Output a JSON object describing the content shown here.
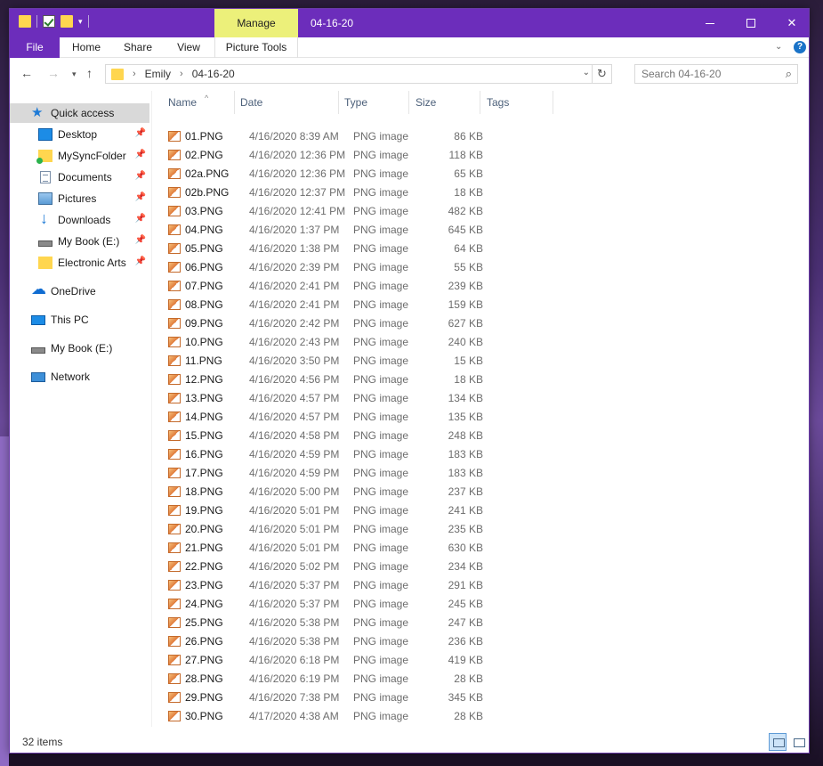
{
  "window": {
    "title": "04-16-20",
    "manage_label": "Manage",
    "controls": {
      "minimize": "minimize",
      "maximize": "maximize",
      "close": "✕"
    }
  },
  "ribbon": {
    "tabs": [
      "File",
      "Home",
      "Share",
      "View",
      "Picture Tools"
    ],
    "help": "?"
  },
  "address": {
    "crumbs": [
      "Emily",
      "04-16-20"
    ],
    "search_placeholder": "Search 04-16-20"
  },
  "nav": {
    "quick_access": "Quick access",
    "pinned": [
      {
        "label": "Desktop",
        "icon": "desktop-icon"
      },
      {
        "label": "MySyncFolder",
        "icon": "sync-folder-icon"
      },
      {
        "label": "Documents",
        "icon": "documents-icon"
      },
      {
        "label": "Pictures",
        "icon": "pictures-icon"
      },
      {
        "label": "Downloads",
        "icon": "downloads-icon"
      },
      {
        "label": "My Book (E:)",
        "icon": "drive-icon"
      },
      {
        "label": "Electronic Arts",
        "icon": "folder-icon"
      }
    ],
    "onedrive": "OneDrive",
    "this_pc": "This PC",
    "mybook": "My Book (E:)",
    "network": "Network"
  },
  "columns": [
    "Name",
    "Date",
    "Type",
    "Size",
    "Tags"
  ],
  "files": [
    {
      "name": "01.PNG",
      "date": "4/16/2020 8:39 AM",
      "type": "PNG image",
      "size": "86 KB"
    },
    {
      "name": "02.PNG",
      "date": "4/16/2020 12:36 PM",
      "type": "PNG image",
      "size": "118 KB"
    },
    {
      "name": "02a.PNG",
      "date": "4/16/2020 12:36 PM",
      "type": "PNG image",
      "size": "65 KB"
    },
    {
      "name": "02b.PNG",
      "date": "4/16/2020 12:37 PM",
      "type": "PNG image",
      "size": "18 KB"
    },
    {
      "name": "03.PNG",
      "date": "4/16/2020 12:41 PM",
      "type": "PNG image",
      "size": "482 KB"
    },
    {
      "name": "04.PNG",
      "date": "4/16/2020 1:37 PM",
      "type": "PNG image",
      "size": "645 KB"
    },
    {
      "name": "05.PNG",
      "date": "4/16/2020 1:38 PM",
      "type": "PNG image",
      "size": "64 KB"
    },
    {
      "name": "06.PNG",
      "date": "4/16/2020 2:39 PM",
      "type": "PNG image",
      "size": "55 KB"
    },
    {
      "name": "07.PNG",
      "date": "4/16/2020 2:41 PM",
      "type": "PNG image",
      "size": "239 KB"
    },
    {
      "name": "08.PNG",
      "date": "4/16/2020 2:41 PM",
      "type": "PNG image",
      "size": "159 KB"
    },
    {
      "name": "09.PNG",
      "date": "4/16/2020 2:42 PM",
      "type": "PNG image",
      "size": "627 KB"
    },
    {
      "name": "10.PNG",
      "date": "4/16/2020 2:43 PM",
      "type": "PNG image",
      "size": "240 KB"
    },
    {
      "name": "11.PNG",
      "date": "4/16/2020 3:50 PM",
      "type": "PNG image",
      "size": "15 KB"
    },
    {
      "name": "12.PNG",
      "date": "4/16/2020 4:56 PM",
      "type": "PNG image",
      "size": "18 KB"
    },
    {
      "name": "13.PNG",
      "date": "4/16/2020 4:57 PM",
      "type": "PNG image",
      "size": "134 KB"
    },
    {
      "name": "14.PNG",
      "date": "4/16/2020 4:57 PM",
      "type": "PNG image",
      "size": "135 KB"
    },
    {
      "name": "15.PNG",
      "date": "4/16/2020 4:58 PM",
      "type": "PNG image",
      "size": "248 KB"
    },
    {
      "name": "16.PNG",
      "date": "4/16/2020 4:59 PM",
      "type": "PNG image",
      "size": "183 KB"
    },
    {
      "name": "17.PNG",
      "date": "4/16/2020 4:59 PM",
      "type": "PNG image",
      "size": "183 KB"
    },
    {
      "name": "18.PNG",
      "date": "4/16/2020 5:00 PM",
      "type": "PNG image",
      "size": "237 KB"
    },
    {
      "name": "19.PNG",
      "date": "4/16/2020 5:01 PM",
      "type": "PNG image",
      "size": "241 KB"
    },
    {
      "name": "20.PNG",
      "date": "4/16/2020 5:01 PM",
      "type": "PNG image",
      "size": "235 KB"
    },
    {
      "name": "21.PNG",
      "date": "4/16/2020 5:01 PM",
      "type": "PNG image",
      "size": "630 KB"
    },
    {
      "name": "22.PNG",
      "date": "4/16/2020 5:02 PM",
      "type": "PNG image",
      "size": "234 KB"
    },
    {
      "name": "23.PNG",
      "date": "4/16/2020 5:37 PM",
      "type": "PNG image",
      "size": "291 KB"
    },
    {
      "name": "24.PNG",
      "date": "4/16/2020 5:37 PM",
      "type": "PNG image",
      "size": "245 KB"
    },
    {
      "name": "25.PNG",
      "date": "4/16/2020 5:38 PM",
      "type": "PNG image",
      "size": "247 KB"
    },
    {
      "name": "26.PNG",
      "date": "4/16/2020 5:38 PM",
      "type": "PNG image",
      "size": "236 KB"
    },
    {
      "name": "27.PNG",
      "date": "4/16/2020 6:18 PM",
      "type": "PNG image",
      "size": "419 KB"
    },
    {
      "name": "28.PNG",
      "date": "4/16/2020 6:19 PM",
      "type": "PNG image",
      "size": "28 KB"
    },
    {
      "name": "29.PNG",
      "date": "4/16/2020 7:38 PM",
      "type": "PNG image",
      "size": "345 KB"
    },
    {
      "name": "30.PNG",
      "date": "4/17/2020 4:38 AM",
      "type": "PNG image",
      "size": "28 KB"
    }
  ],
  "status": {
    "count": "32 items"
  },
  "colors": {
    "titlebar": "#6c2dbb",
    "manage_tab": "#ecf07a",
    "selection": "#d9d9d9"
  }
}
